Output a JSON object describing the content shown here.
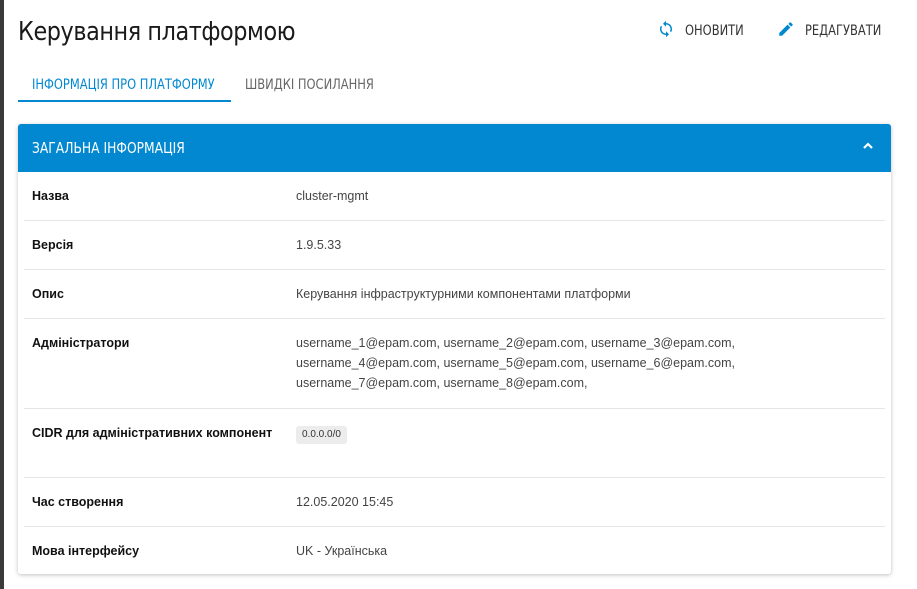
{
  "header": {
    "title": "Керування платформою",
    "actions": {
      "refresh_label": "Оновити",
      "edit_label": "Редагувати"
    }
  },
  "tabs": [
    {
      "label": "Інформація про платформу",
      "active": true
    },
    {
      "label": "Швидкі посилання",
      "active": false
    }
  ],
  "card": {
    "title": "Загальна інформація",
    "rows": {
      "name": {
        "key": "Назва",
        "value": "cluster-mgmt"
      },
      "version": {
        "key": "Версія",
        "value": "1.9.5.33"
      },
      "description": {
        "key": "Опис",
        "value": "Керування інфраструктурними компонентами платформи"
      },
      "admins": {
        "key": "Адміністратори",
        "lines": [
          "username_1@epam.com, username_2@epam.com, username_3@epam.com,",
          "username_4@epam.com, username_5@epam.com, username_6@epam.com,",
          "username_7@epam.com, username_8@epam.com,"
        ]
      },
      "cidr": {
        "key": "CIDR для адміністративних компонент",
        "chip": "0.0.0.0/0"
      },
      "created": {
        "key": "Час створення",
        "value": "12.05.2020 15:45"
      },
      "language": {
        "key": "Мова інтерфейсу",
        "value": "UK - Українська"
      }
    }
  },
  "colors": {
    "accent": "#0288d1",
    "header_text": "#ffffff"
  },
  "icons": {
    "refresh": "refresh-icon",
    "edit": "pencil-icon",
    "collapse": "chevron-up-icon"
  }
}
